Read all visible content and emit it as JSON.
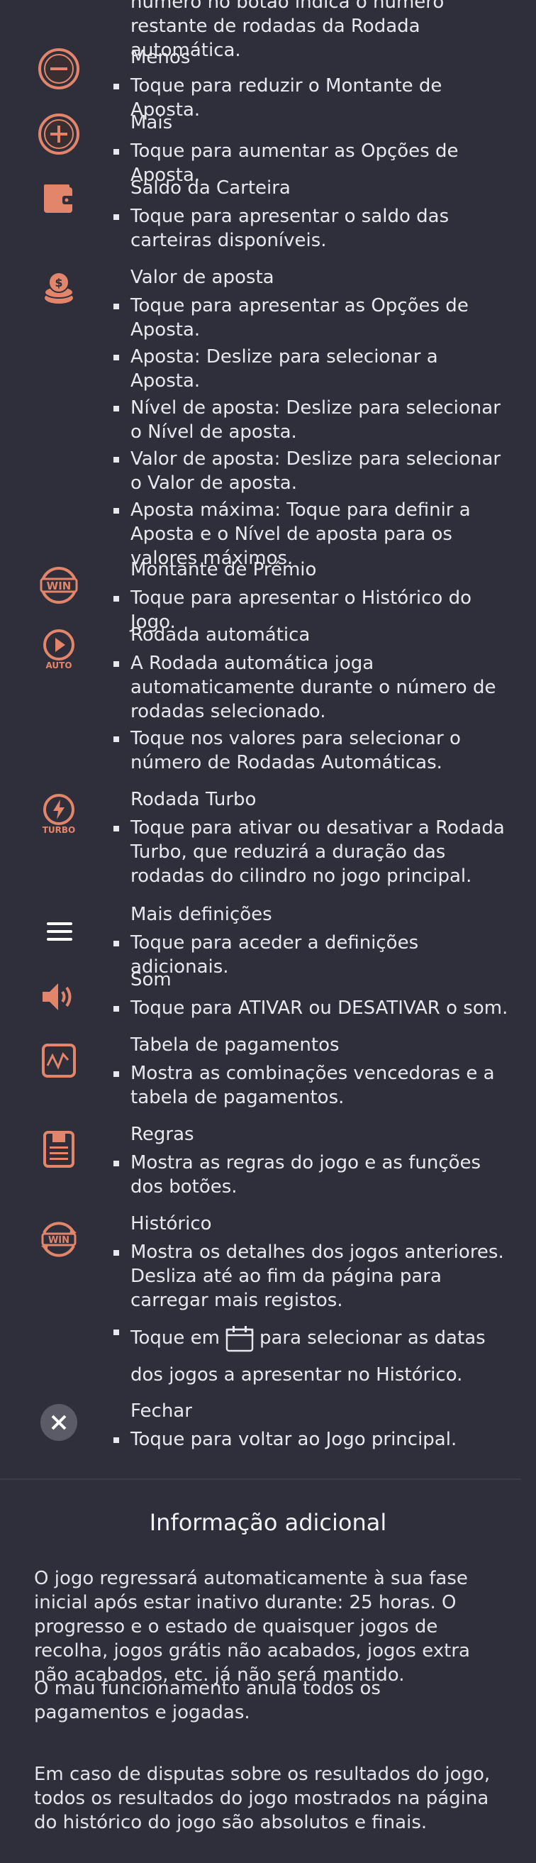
{
  "top_fragment": "número no botão indica o número restante de rodadas da Rodada automática.",
  "items": [
    {
      "title": "Menos",
      "icon": "minus-circle-icon",
      "bullets": [
        "Toque para reduzir o Montante de Aposta."
      ]
    },
    {
      "title": "Mais",
      "icon": "plus-circle-icon",
      "bullets": [
        "Toque para aumentar as Opções de Aposta."
      ]
    },
    {
      "title": "Saldo da Carteira",
      "icon": "wallet-icon",
      "bullets": [
        "Toque para apresentar o saldo das carteiras disponíveis."
      ]
    },
    {
      "title": "Valor de aposta",
      "icon": "coins-icon",
      "bullets": [
        "Toque para apresentar as Opções de Aposta.",
        "Aposta: Deslize para selecionar a Aposta.",
        "Nível de aposta: Deslize para selecionar o Nível de aposta.",
        "Valor de aposta: Deslize para selecionar o Valor de aposta.",
        "Aposta máxima: Toque para definir a Aposta e o Nível de aposta para os valores máximos."
      ]
    },
    {
      "title": "Montante de Prémio",
      "icon": "win-badge-icon",
      "bullets": [
        "Toque para apresentar o Histórico do Jogo."
      ]
    },
    {
      "title": "Rodada automática",
      "icon": "autoplay-icon",
      "icon_label": "AUTO",
      "bullets": [
        "A Rodada automática joga automaticamente durante o número de rodadas selecionado.",
        "Toque nos valores para selecionar o número de Rodadas Automáticas."
      ]
    },
    {
      "title": "Rodada Turbo",
      "icon": "turbo-icon",
      "icon_label": "TURBO",
      "bullets": [
        "Toque para ativar ou desativar a Rodada Turbo, que reduzirá a duração das rodadas do cilindro no jogo principal."
      ]
    },
    {
      "title": "Mais definições",
      "icon": "menu-icon",
      "bullets": [
        "Toque para aceder a definições adicionais."
      ]
    },
    {
      "title": "Som",
      "icon": "speaker-icon",
      "bullets": [
        "Toque para ATIVAR ou DESATIVAR o som."
      ]
    },
    {
      "title": "Tabela de pagamentos",
      "icon": "paytable-icon",
      "bullets": [
        "Mostra as combinações vencedoras e a tabela de pagamentos."
      ]
    },
    {
      "title": "Regras",
      "icon": "rules-icon",
      "bullets": [
        "Mostra as regras do jogo e as funções dos botões."
      ]
    },
    {
      "title": "Histórico",
      "icon": "history-icon",
      "bullets": [
        "Mostra os detalhes dos jogos anteriores. Desliza até ao fim da página para carregar mais registos."
      ],
      "calendar_bullet": {
        "before": "Toque em",
        "after": "para selecionar as datas dos jogos a apresentar no Histórico."
      }
    },
    {
      "title": "Fechar",
      "icon": "close-icon",
      "bullets": [
        "Toque para voltar ao Jogo principal."
      ]
    }
  ],
  "win_label": "WIN",
  "info": {
    "title": "Informação adicional",
    "paragraphs": [
      "O jogo regressará automaticamente à sua fase inicial após estar inativo durante: 25 horas. O progresso e o estado de quaisquer jogos de recolha, jogos grátis não acabados, jogos extra não acabados, etc. já não será mantido.",
      "O mau funcionamento anula todos os pagamentos e jogadas.",
      "Em caso de disputas sobre os resultados do jogo, todos os resultados do jogo mostrados na página do histórico do jogo são absolutos e finais."
    ]
  },
  "colors": {
    "background": "#2e2f3a",
    "accent": "#e2856a",
    "close_bg": "#5a5b66"
  }
}
